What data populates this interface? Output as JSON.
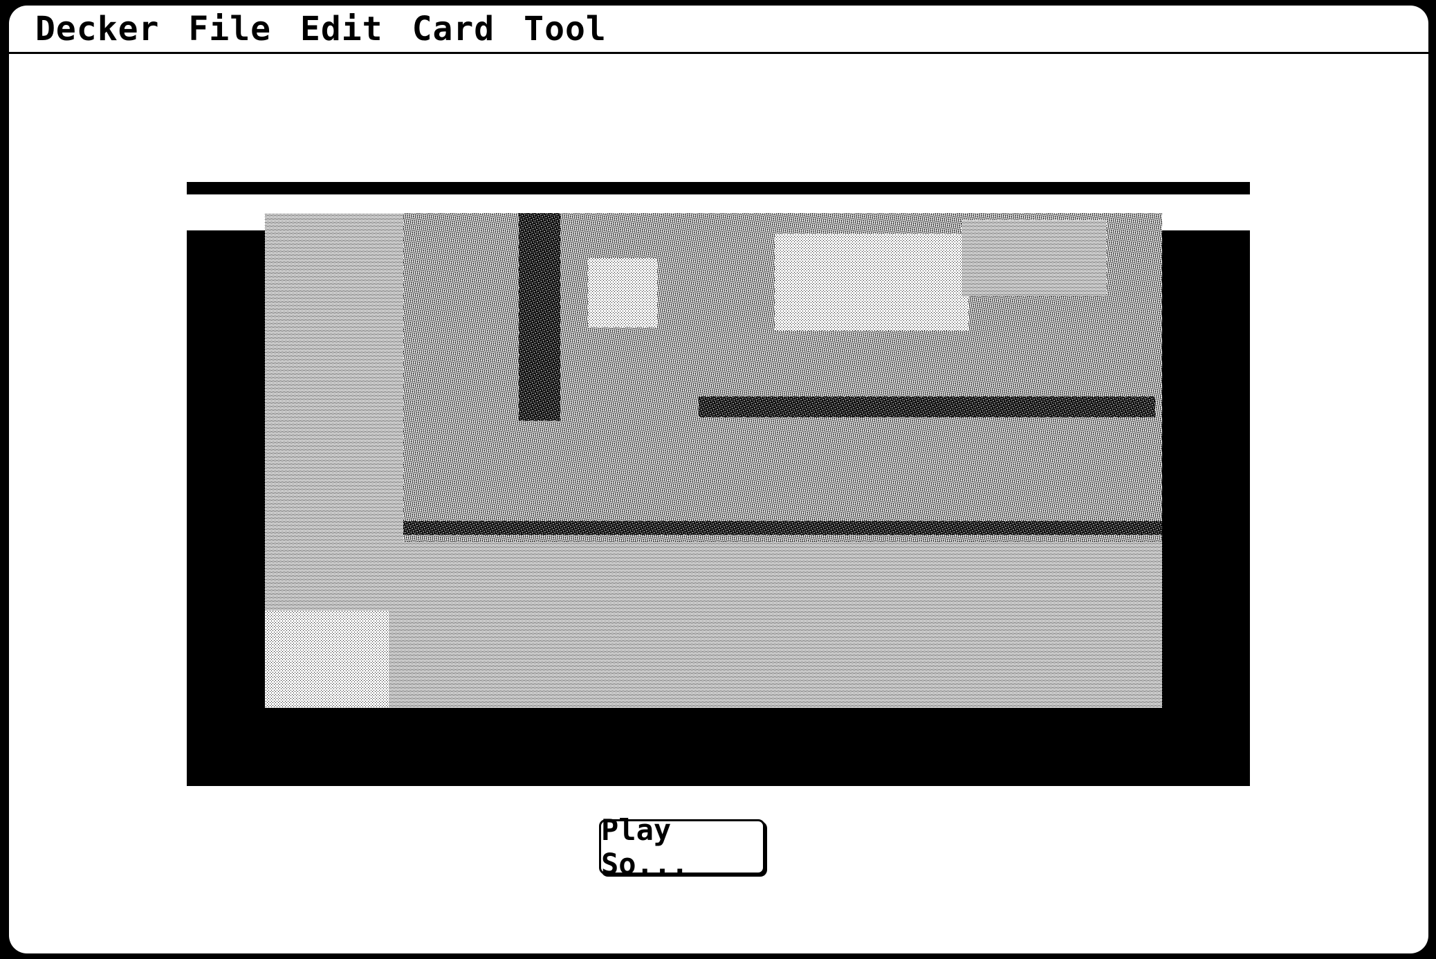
{
  "menubar": {
    "items": [
      {
        "label": "Decker"
      },
      {
        "label": "File"
      },
      {
        "label": "Edit"
      },
      {
        "label": "Card"
      },
      {
        "label": "Tool"
      }
    ]
  },
  "card": {
    "play_button_label": "Play So..."
  },
  "colors": {
    "foreground": "#000000",
    "background": "#ffffff"
  }
}
